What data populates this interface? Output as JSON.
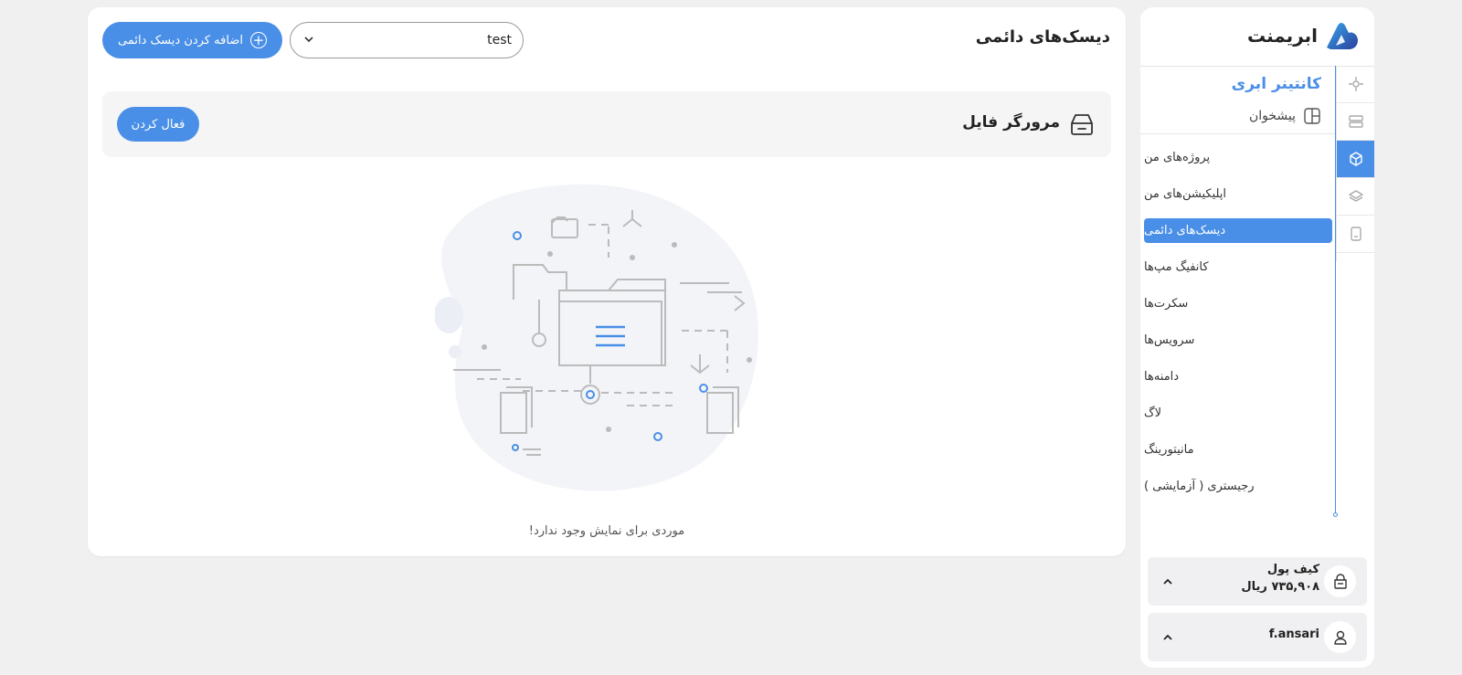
{
  "header": {
    "page_title": "دیسک‌های دائمی",
    "add_button_label": "اضافه کردن دیسک دائمی",
    "project_select_value": "test"
  },
  "file_browser": {
    "title": "مرورگر فایل",
    "activate_label": "فعال کردن"
  },
  "empty_state": {
    "message": "موردی برای نمایش وجود ندارد!"
  },
  "sidebar": {
    "brand": "ابریمنت",
    "section_title": "کانتینر ابری",
    "dashboard_label": "پیشخوان",
    "nav_items": [
      {
        "label": "پروژه‌های من"
      },
      {
        "label": "اپلیکیشن‌های من"
      },
      {
        "label": "دیسک‌های دائمی"
      },
      {
        "label": "کانفیگ مپ‌ها"
      },
      {
        "label": "سکرت‌ها"
      },
      {
        "label": "سرویس‌ها"
      },
      {
        "label": "دامنه‌ها"
      },
      {
        "label": "لاگ"
      },
      {
        "label": "مانیتورینگ"
      },
      {
        "label": "رجیستری ( آزمایشی )"
      }
    ],
    "active_index": 2,
    "rail_icons": [
      "kubernetes-icon",
      "server-icon",
      "cube-icon",
      "layers-icon",
      "storage-icon"
    ],
    "wallet_label": "کیف پول",
    "wallet_amount": "۷۳۵,۹۰۸ ریال",
    "username": "f.ansari"
  },
  "colors": {
    "accent": "#4a8fe7",
    "background": "#f0f0f0"
  }
}
